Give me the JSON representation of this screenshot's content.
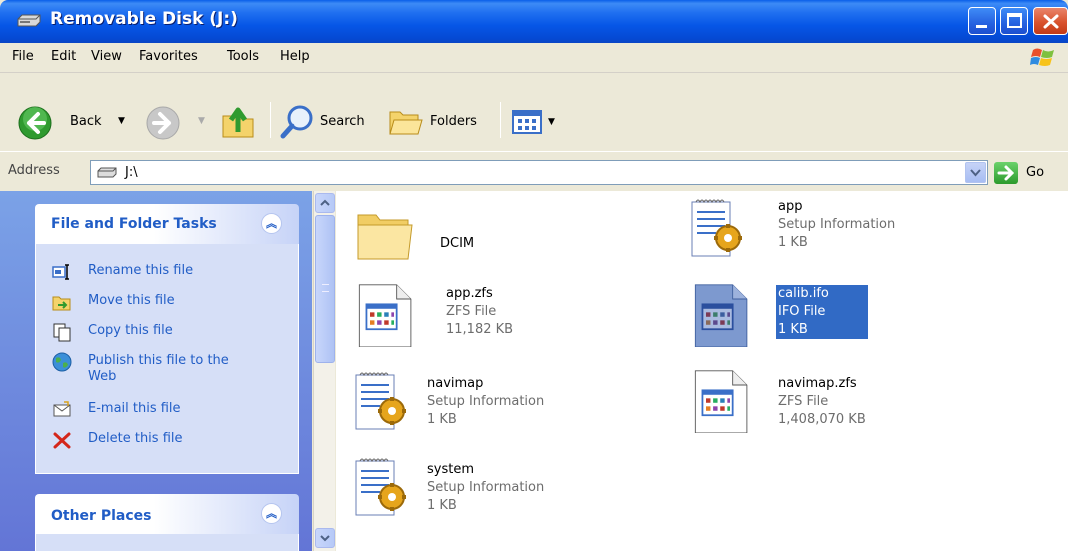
{
  "window": {
    "title": "Removable Disk (J:)"
  },
  "menu": {
    "items": [
      "File",
      "Edit",
      "View",
      "Favorites",
      "Tools",
      "Help"
    ]
  },
  "toolbar": {
    "back_label": "Back",
    "search_label": "Search",
    "folders_label": "Folders"
  },
  "address": {
    "label": "Address",
    "value": "J:\\",
    "go_label": "Go"
  },
  "taskpane": {
    "file_tasks": {
      "title": "File and Folder Tasks",
      "items": [
        {
          "label": "Rename this file",
          "icon": "rename-icon"
        },
        {
          "label": "Move this file",
          "icon": "move-icon"
        },
        {
          "label": "Copy this file",
          "icon": "copy-icon"
        },
        {
          "label": "Publish this file to the",
          "label2": "Web",
          "icon": "publish-web-icon"
        },
        {
          "label": "E-mail this file",
          "icon": "email-icon"
        },
        {
          "label": "Delete this file",
          "icon": "delete-icon"
        }
      ]
    },
    "other_places": {
      "title": "Other Places"
    }
  },
  "files": [
    {
      "name": "DCIM",
      "type": "",
      "size": "",
      "icon": "folder-icon"
    },
    {
      "name": "app",
      "type": "Setup Information",
      "size": "1 KB",
      "icon": "setup-info-icon"
    },
    {
      "name": "app.zfs",
      "type": "ZFS File",
      "size": "11,182 KB",
      "icon": "generic-app-file-icon"
    },
    {
      "name": "calib.ifo",
      "type": "IFO File",
      "size": "1 KB",
      "icon": "generic-app-file-icon",
      "selected": true
    },
    {
      "name": "navimap",
      "type": "Setup Information",
      "size": "1 KB",
      "icon": "setup-info-icon"
    },
    {
      "name": "navimap.zfs",
      "type": "ZFS File",
      "size": "1,408,070 KB",
      "icon": "generic-app-file-icon"
    },
    {
      "name": "system",
      "type": "Setup Information",
      "size": "1 KB",
      "icon": "setup-info-icon"
    }
  ],
  "colors": {
    "titlebar_blue": "#0656e6",
    "taskpane_blue": "#6375d6",
    "link_blue": "#215dc6",
    "selection_blue": "#316ac5"
  }
}
